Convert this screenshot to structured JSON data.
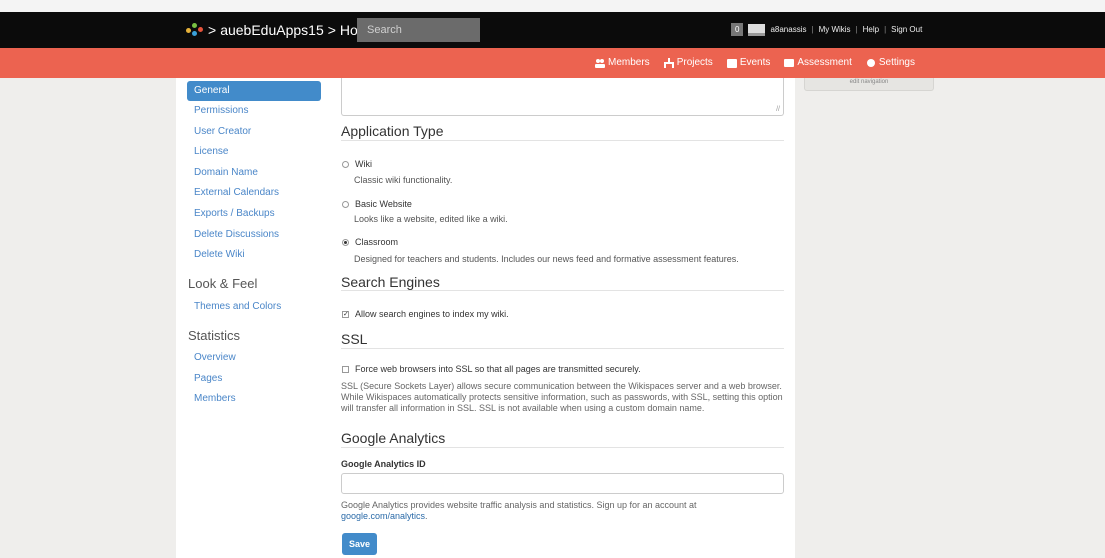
{
  "header": {
    "site_name": "auebEduApps15",
    "separator": ">",
    "page": "Home",
    "search_placeholder": "Search",
    "notifications_count": "0",
    "username": "a8anassis",
    "links": [
      "My Wikis",
      "Help",
      "Sign Out"
    ]
  },
  "nav": [
    {
      "label": "Members",
      "icon": "members-icon"
    },
    {
      "label": "Projects",
      "icon": "projects-icon"
    },
    {
      "label": "Events",
      "icon": "calendar-icon"
    },
    {
      "label": "Assessment",
      "icon": "assessment-icon"
    },
    {
      "label": "Settings",
      "icon": "gear-icon"
    }
  ],
  "sidebar": {
    "items": [
      "General",
      "Permissions",
      "User Creator",
      "License",
      "Domain Name",
      "External Calendars",
      "Exports / Backups",
      "Delete Discussions",
      "Delete Wiki"
    ],
    "look_heading": "Look & Feel",
    "look_items": [
      "Themes and Colors"
    ],
    "stats_heading": "Statistics",
    "stats_items": [
      "Overview",
      "Pages",
      "Members"
    ]
  },
  "right_panel": {
    "label": "edit navigation"
  },
  "app_type": {
    "title": "Application Type",
    "options": [
      {
        "label": "Wiki",
        "desc": "Classic wiki functionality.",
        "selected": false
      },
      {
        "label": "Basic Website",
        "desc": "Looks like a website, edited like a wiki.",
        "selected": false
      },
      {
        "label": "Classroom",
        "desc": "Designed for teachers and students. Includes our news feed and formative assessment features.",
        "selected": true
      }
    ]
  },
  "search_engines": {
    "title": "Search Engines",
    "checkbox_label": "Allow search engines to index my wiki.",
    "checked": true
  },
  "ssl": {
    "title": "SSL",
    "checkbox_label": "Force web browsers into SSL so that all pages are transmitted securely.",
    "checked": false,
    "description": "SSL (Secure Sockets Layer) allows secure communication between the Wikispaces server and a web browser. While Wikispaces automatically protects sensitive information, such as passwords, with SSL, setting this option will transfer all information in SSL. SSL is not available when using a custom domain name."
  },
  "analytics": {
    "title": "Google Analytics",
    "field_label": "Google Analytics ID",
    "value": "",
    "description": "Google Analytics provides website traffic analysis and statistics. Sign up for an account at",
    "link": "google.com/analytics",
    "link_suffix": "."
  },
  "save_label": "Save"
}
